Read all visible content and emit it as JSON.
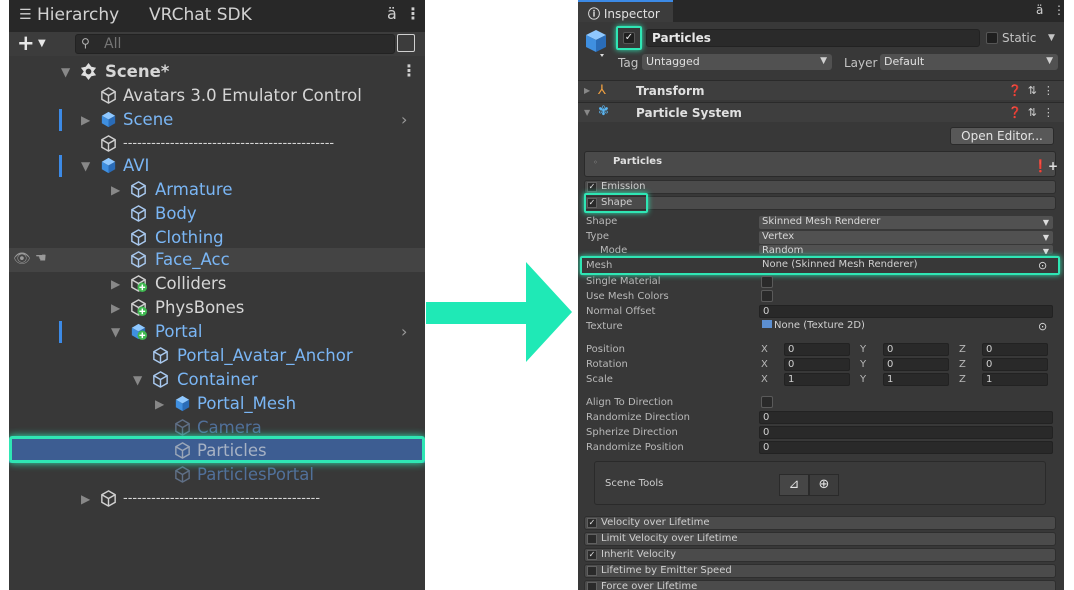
{
  "hierarchy": {
    "tab_hierarchy": "Hierarchy",
    "tab_sdk": "VRChat SDK",
    "lock_icon": "ä",
    "menu_icon": "⋮",
    "add_icon": "+",
    "search_placeholder": "All",
    "rows": [
      {
        "label": "Scene*"
      },
      {
        "label": "Avatars 3.0 Emulator Control"
      },
      {
        "label": "Scene"
      },
      {
        "label": "---------------------------------------------"
      },
      {
        "label": "AVI"
      },
      {
        "label": "Armature"
      },
      {
        "label": "Body"
      },
      {
        "label": "Clothing"
      },
      {
        "label": "Face_Acc"
      },
      {
        "label": "Colliders"
      },
      {
        "label": "PhysBones"
      },
      {
        "label": "Portal"
      },
      {
        "label": "Portal_Avatar_Anchor"
      },
      {
        "label": "Container"
      },
      {
        "label": "Portal_Mesh"
      },
      {
        "label": "Camera"
      },
      {
        "label": "Particles"
      },
      {
        "label": "ParticlesPortal"
      },
      {
        "label": "------------------------------------------"
      }
    ]
  },
  "inspector": {
    "tab_label": "Inspector",
    "go_name": "Particles",
    "static_label": "Static",
    "tag_label": "Tag",
    "tag_value": "Untagged",
    "layer_label": "Layer",
    "layer_value": "Default",
    "components": [
      {
        "label": "Transform"
      },
      {
        "label": "Particle System"
      }
    ],
    "open_editor": "Open Editor...",
    "ps_title": "Particles",
    "modules_top": [
      {
        "label": "Emission",
        "checked": true
      },
      {
        "label": "Shape",
        "checked": true
      }
    ],
    "shape": {
      "shape_label": "Shape",
      "shape_value": "Skinned Mesh Renderer",
      "type_label": "Type",
      "type_value": "Vertex",
      "mode_label": "Mode",
      "mode_value": "Random",
      "mesh_label": "Mesh",
      "mesh_value": "None (Skinned Mesh Renderer)",
      "single_material_label": "Single Material",
      "use_mesh_colors_label": "Use Mesh Colors",
      "normal_offset_label": "Normal Offset",
      "normal_offset_value": "0",
      "texture_label": "Texture",
      "texture_value": "None (Texture 2D)",
      "position_label": "Position",
      "rotation_label": "Rotation",
      "scale_label": "Scale",
      "position": [
        "0",
        "0",
        "0"
      ],
      "rotation": [
        "0",
        "0",
        "0"
      ],
      "scale": [
        "1",
        "1",
        "1"
      ],
      "axis_x": "X",
      "axis_y": "Y",
      "axis_z": "Z",
      "align_label": "Align To Direction",
      "randomize_dir_label": "Randomize Direction",
      "randomize_dir_value": "0",
      "spherize_label": "Spherize Direction",
      "spherize_value": "0",
      "randomize_pos_label": "Randomize Position",
      "randomize_pos_value": "0",
      "scene_tools_label": "Scene Tools"
    },
    "modules_bottom": [
      {
        "label": "Velocity over Lifetime",
        "checked": true
      },
      {
        "label": "Limit Velocity over Lifetime",
        "checked": false
      },
      {
        "label": "Inherit Velocity",
        "checked": true
      },
      {
        "label": "Lifetime by Emitter Speed",
        "checked": false
      },
      {
        "label": "Force over Lifetime",
        "checked": false
      }
    ]
  },
  "colors": {
    "highlight": "#2fe6b4",
    "selection": "#3d5d92",
    "prefab_blue": "#7ab6f5"
  }
}
